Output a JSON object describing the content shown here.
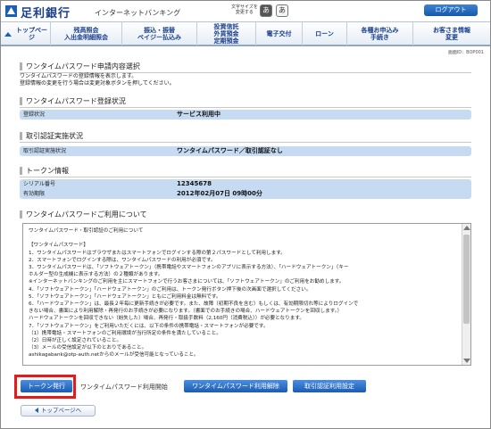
{
  "header": {
    "bank_name": "足利銀行",
    "service_name": "インターネットバンキング",
    "font_size_label": "文字サイズを\n変更する",
    "font_small": "あ",
    "font_large": "あ",
    "logout": "ログアウト"
  },
  "nav": {
    "items": [
      {
        "label": "トップページ"
      },
      {
        "label": "残高照会\n入出金明細照会"
      },
      {
        "label": "振込・振替\nペイジー払込み"
      },
      {
        "label": "投資信託\n外貨預金\n定期預金"
      },
      {
        "label": "電子交付"
      },
      {
        "label": "ローン"
      },
      {
        "label": "各種お申込み\n手続き"
      },
      {
        "label": "お客さま情報\n変更"
      }
    ]
  },
  "screen_id": "画面ID：BOP001",
  "page": {
    "title": "ワンタイムパスワード申請内容選択",
    "desc1": "ワンタイムパスワードの登録情報を表示します。",
    "desc2": "登録情報の変更を行う場合は変更対象ボタンを押してください。"
  },
  "registration": {
    "title": "ワンタイムパスワード登録状況",
    "label": "登録状況",
    "value": "サービス利用中"
  },
  "auth": {
    "title": "取引認証実施状況",
    "label": "取引認証実施状況",
    "value": "ワンタイムパスワード／取引認証なし"
  },
  "token": {
    "title": "トークン情報",
    "serial_label": "シリアル番号",
    "serial_value": "12345678",
    "expiry_label": "有効期限",
    "expiry_value": "2012年02月07日 09時00分"
  },
  "usage": {
    "title": "ワンタイムパスワードご利用について",
    "lines": [
      "ワンタイムパスワード・取引認証のご利用について",
      "",
      "【ワンタイムパスワード】",
      "1．ワンタイムパスワードはブラウザまたはスマートフォンでログインする際の第２パスワードとして利用します。",
      "2．スマートフォンでログインする際は、ワンタイムパスワードの利用が必須です。",
      "3．ワンタイムパスワードは、「ソフトウェアトークン」（携帯電話やスマートフォンのアプリに表示する方法）、「ハードウェアトークン」（キー",
      "   ホルダー型の生成機に表示する方法）の２種類があります。",
      "   ※インターネットバンキングのご利用を主にスマートフォンで行うお客さまについては、「ソフトウェアトークン」のご利用をお勧めします。",
      "4．「ソフトウェアトークン」「ハードウェアトークン」のご利用は、トークン発行ボタン押下後の次画面で選択してください。",
      "5．「ソフトウェアトークン」「ハードウェアトークン」ともにご利用料金は無料です。",
      "6．「ハードウェアトークン」は、最長２年毎に更新手続きが必要です。また、故障（初期不良を含む）もしくは、有効期限切れ等によりログインで",
      "   きない場合、書面により利用解除・再発行のお手続きが必要になります。（書面でのお手続きの場合、ハードウェアトークンを回収します。）",
      "   ハードウェアトークンを回収できない（紛失した）場合、再発行・取扱手数料（2,160円（消費税込））が必要となります。",
      "7．「ソフトウェアトークン」をご利用いただくには、以下の条件の携帯電話・スマートフォンが必要です。",
      "（1）携帯電話・スマートフォンのご利用環境が当行所定の条件を満たしていること。",
      "（2）日時が正しく設定されていること。",
      "（3）メールの受信設定が以下のとおりであること。",
      "   ashikagabank@otp-auth.netからのメールが受信可能となっていること。"
    ]
  },
  "buttons": {
    "token_issue": "トークン発行",
    "token_issue_text": "ワンタイムパスワード利用開始",
    "otp_cancel": "ワンタイムパスワード利用解除",
    "auth_setting": "取引認証利用設定",
    "back_top": "トップページへ"
  }
}
